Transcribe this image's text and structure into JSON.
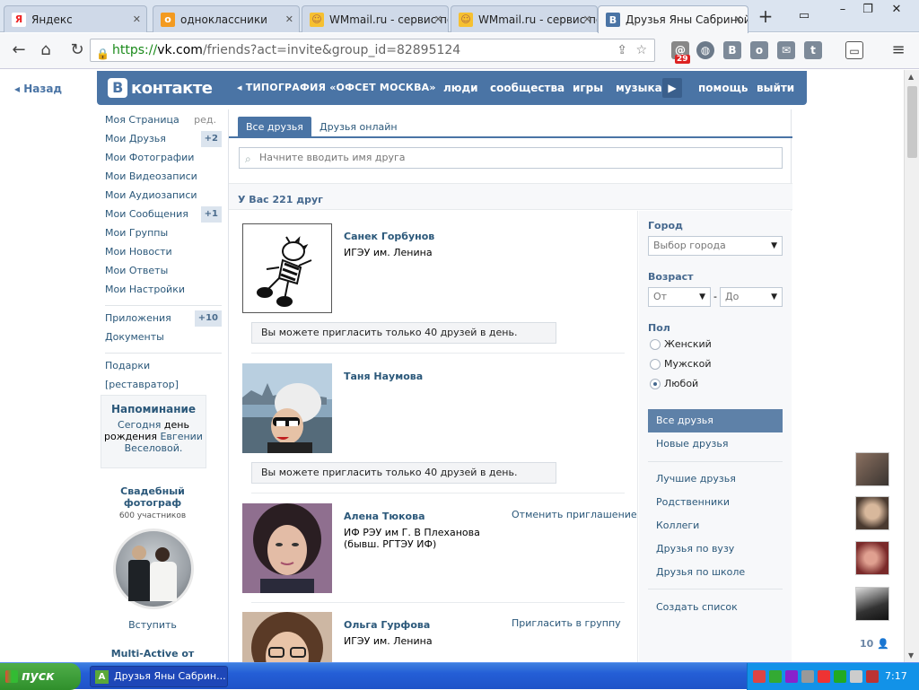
{
  "tabs": [
    {
      "label": "Яндекс"
    },
    {
      "label": "одноклассники"
    },
    {
      "label": "WMmail.ru - сервис по"
    },
    {
      "label": "WMmail.ru - сервис по"
    },
    {
      "label": "Друзья Яны Сабриной"
    }
  ],
  "address": {
    "scheme": "https://",
    "host": "vk.com",
    "path": "/friends?act=invite&group_id=82895124"
  },
  "toolbar": {
    "mail_badge": "29"
  },
  "page": {
    "back_label": "Назад"
  },
  "header": {
    "logo_text": "контакте",
    "group_label": "ТИПОГРАФИЯ «ОФСЕТ МОСКВА»",
    "nav": [
      "люди",
      "сообщества",
      "игры",
      "музыка",
      "помощь",
      "выйти"
    ]
  },
  "menu": {
    "edit_label": "ред.",
    "items": [
      {
        "label": "Моя Страница"
      },
      {
        "label": "Мои Друзья",
        "count": "+2"
      },
      {
        "label": "Мои Фотографии"
      },
      {
        "label": "Мои Видеозаписи"
      },
      {
        "label": "Мои Аудиозаписи"
      },
      {
        "label": "Мои Сообщения",
        "count": "+1"
      },
      {
        "label": "Мои Группы"
      },
      {
        "label": "Мои Новости"
      },
      {
        "label": "Мои Ответы"
      },
      {
        "label": "Мои Настройки"
      },
      {
        "label": "Приложения",
        "count": "+10"
      },
      {
        "label": "Документы"
      },
      {
        "label": "Подарки"
      },
      {
        "label": "[реставратор]"
      }
    ]
  },
  "reminder": {
    "title": "Напоминание",
    "today": "Сегодня",
    "text": "день рождения",
    "person": "Евгении Веселовой."
  },
  "ad": {
    "title": "Свадебный фотограф",
    "members": "600 участников",
    "join_label": "Вступить",
    "second_title": "Multi-Active от"
  },
  "friends": {
    "tabs": [
      "Все друзья",
      "Друзья онлайн"
    ],
    "search_placeholder": "Начните вводить имя друга",
    "count_label": "У Вас 221 друг",
    "list": [
      {
        "name": "Санек Горбунов",
        "info": "ИГЭУ им. Ленина",
        "notice": "Вы можете пригласить только 40 друзей в день."
      },
      {
        "name": "Таня Наумова",
        "notice": "Вы можете пригласить только 40 друзей в день."
      },
      {
        "name": "Алена Тюкова",
        "info": "ИФ РЭУ им Г. В Плеханова (бывш. РГТЭУ ИФ)",
        "action": "Отменить приглашение"
      },
      {
        "name": "Ольга Гурфова",
        "info": "ИГЭУ им. Ленина",
        "action": "Пригласить в группу"
      }
    ]
  },
  "filters": {
    "city_label": "Город",
    "city_value": "Выбор города",
    "age_label": "Возраст",
    "age_from": "От",
    "age_dash": "-",
    "age_to": "До",
    "sex_label": "Пол",
    "sex_options": [
      "Женский",
      "Мужской",
      "Любой"
    ],
    "sex_selected": "Любой",
    "lists": [
      "Все друзья",
      "Новые друзья",
      "Лучшие друзья",
      "Родственники",
      "Коллеги",
      "Друзья по вузу",
      "Друзья по школе",
      "Создать список"
    ]
  },
  "sidebar_online": {
    "count": "10"
  },
  "taskbar": {
    "start_label": "пуск",
    "window_label": "Друзья Яны Сабрин...",
    "clock": "7:17"
  },
  "colors": {
    "vk_blue": "#4a74a5",
    "link": "#2b587a",
    "taskbar": "#245ed6",
    "start": "#2f8f2b"
  }
}
